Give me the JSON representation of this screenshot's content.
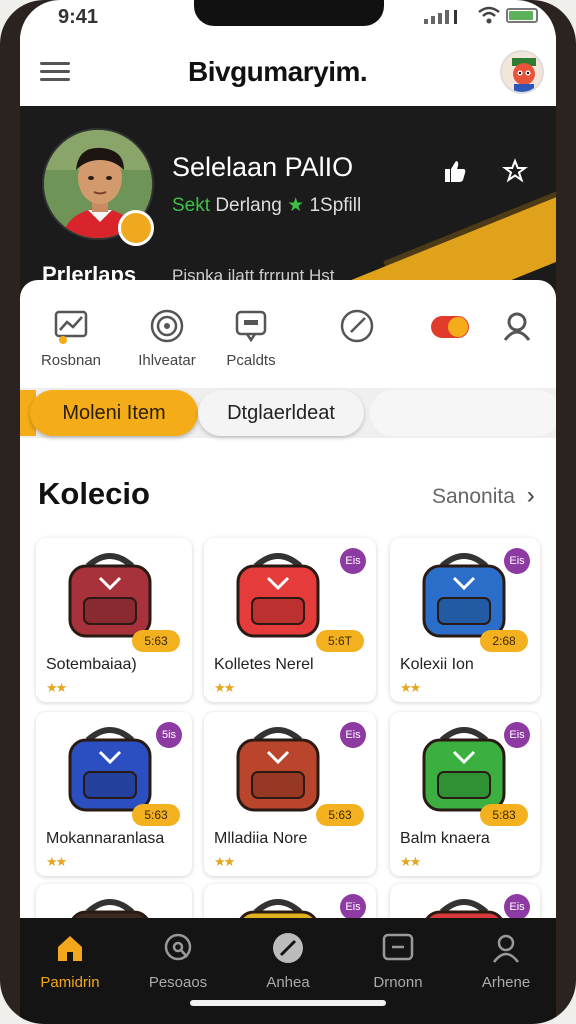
{
  "status": {
    "time": "9:41"
  },
  "header": {
    "title": "Bivgumaryim.",
    "avatar": "user-avatar"
  },
  "hero": {
    "name": "Selelaan PAlIO",
    "sub_green": "Sekt",
    "sub_text": "Derlang",
    "sub_rank": "1Spfill",
    "label": "Prlerlaps",
    "caption": "Pisnka ilatt   frrrunt  Hst"
  },
  "quick_actions": [
    {
      "label": "Rosbnan",
      "icon": "chart-icon"
    },
    {
      "label": "Ihlveatar",
      "icon": "target-icon"
    },
    {
      "label": "Pcaldts",
      "icon": "chat-icon"
    },
    {
      "label": "",
      "icon": "clock-icon"
    },
    {
      "label": "",
      "icon": "toggle-icon"
    },
    {
      "label": "",
      "icon": "profile-icon"
    }
  ],
  "tabs": {
    "active": "Moleni Item",
    "second": "Dtglaerldeat"
  },
  "section": {
    "title": "Kolecio",
    "see_all": "Sanonita"
  },
  "cards": [
    {
      "name": "Sotembaiaa)",
      "price": "5:63",
      "badge": "",
      "stars": "★★",
      "color": "#a8323b"
    },
    {
      "name": "Kolletes Nerel",
      "price": "5:6T",
      "badge": "Eis",
      "stars": "★★",
      "color": "#e63b3b"
    },
    {
      "name": "Kolexii Ion",
      "price": "2:68",
      "badge": "Eis",
      "stars": "★★",
      "color": "#2a6ec9"
    },
    {
      "name": "Mokannaranlasa",
      "price": "5:63",
      "badge": "5is",
      "stars": "★★",
      "color": "#2b4fc0"
    },
    {
      "name": "Mlladiia Nore",
      "price": "5:63",
      "badge": "Eis",
      "stars": "★★",
      "color": "#b8452c"
    },
    {
      "name": "Balm knaera",
      "price": "5:83",
      "badge": "Eis",
      "stars": "★★",
      "color": "#3bb040"
    },
    {
      "name": "",
      "price": "",
      "badge": "",
      "stars": "",
      "color": "#3a2a22"
    },
    {
      "name": "",
      "price": "",
      "badge": "Eis",
      "stars": "",
      "color": "#e0b01f"
    },
    {
      "name": "",
      "price": "",
      "badge": "Eis",
      "stars": "",
      "color": "#d63a3a"
    }
  ],
  "nav": [
    {
      "label": "Pamidrin",
      "icon": "home-icon",
      "active": true
    },
    {
      "label": "Pesoaos",
      "icon": "search-icon",
      "active": false
    },
    {
      "label": "Anhea",
      "icon": "slash-icon",
      "active": false
    },
    {
      "label": "Drnonn",
      "icon": "message-icon",
      "active": false
    },
    {
      "label": "Arhene",
      "icon": "user-icon",
      "active": false
    }
  ],
  "colors": {
    "accent": "#f4ad18",
    "dark": "#1b1b1b",
    "badge": "#8e3aa3"
  }
}
